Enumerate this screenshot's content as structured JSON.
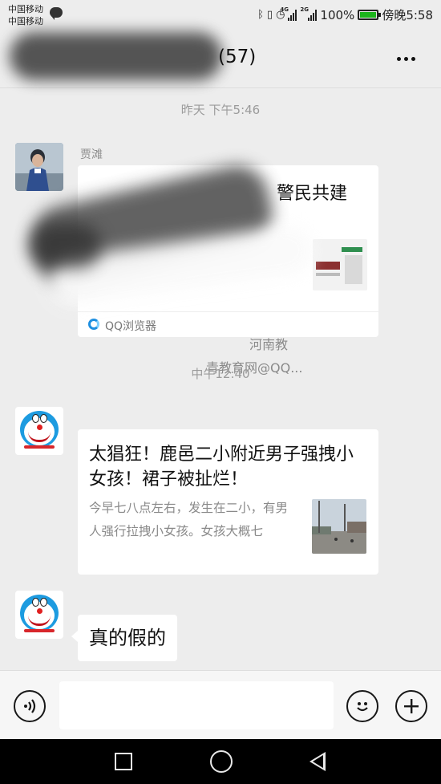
{
  "status_bar": {
    "carrier_1": "中国移动",
    "carrier_2": "中国移动",
    "battery": "100%",
    "battery_level": 1.0,
    "time_label": "傍晚5:58",
    "signal_1": "4G",
    "signal_2": "2G"
  },
  "header": {
    "member_count": "(57)",
    "more_icon": "more-dots-icon"
  },
  "messages": {
    "time_1": "昨天 下午5:46",
    "sender_1": "贾滩",
    "card_1": {
      "title": "警民共建",
      "desc_1": "河南教",
      "desc_2": "青教育网@QQ...",
      "source": "QQ浏览器"
    },
    "time_2": "中午12:40",
    "card_2": {
      "title": "太猖狂！鹿邑二小附近男子强拽小女孩！裙子被扯烂！",
      "desc": "今早七八点左右，发生在二小，有男人强行拉拽小女孩。女孩大概七"
    },
    "text_1": "真的假的"
  },
  "input_bar": {
    "voice_icon": "voice-icon",
    "emoji_icon": "emoji-icon",
    "plus_icon": "plus-icon"
  },
  "nav": {
    "recent_icon": "square-icon",
    "home_icon": "circle-icon",
    "back_icon": "back-triangle-icon"
  },
  "colors": {
    "background": "#ededed",
    "bubble": "#ffffff",
    "battery_green": "#1db41d",
    "qq_blue": "#1e8fe0",
    "doraemon_blue": "#1d9be0"
  }
}
